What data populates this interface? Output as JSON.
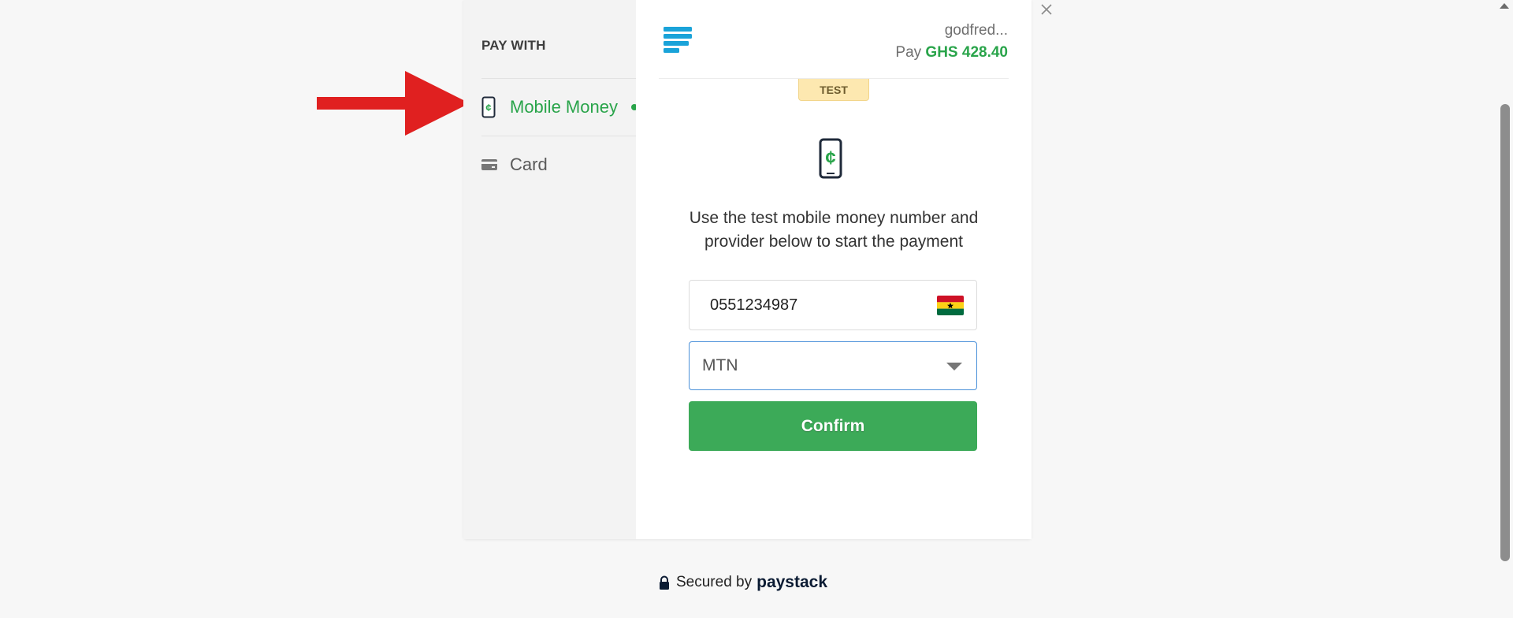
{
  "sidebar": {
    "heading": "PAY WITH",
    "items": [
      {
        "label": "Mobile Money",
        "icon": "mobile-money-icon",
        "active": true
      },
      {
        "label": "Card",
        "icon": "card-icon",
        "active": false
      }
    ]
  },
  "header": {
    "merchant": "godfred...",
    "pay_label": "Pay",
    "amount": "GHS 428.40"
  },
  "badge": "TEST",
  "instructions": "Use the test mobile money number and provider below to start the payment",
  "form": {
    "phone_value": "0551234987",
    "phone_country_flag": "ghana-flag-icon",
    "provider_value": "MTN",
    "confirm_label": "Confirm"
  },
  "footer": {
    "secured_by": "Secured by",
    "brand": "paystack"
  },
  "colors": {
    "accent_green": "#29a44a",
    "button_green": "#3caa58",
    "logo_blue": "#1aa3d9",
    "arrow_red": "#e02020"
  }
}
